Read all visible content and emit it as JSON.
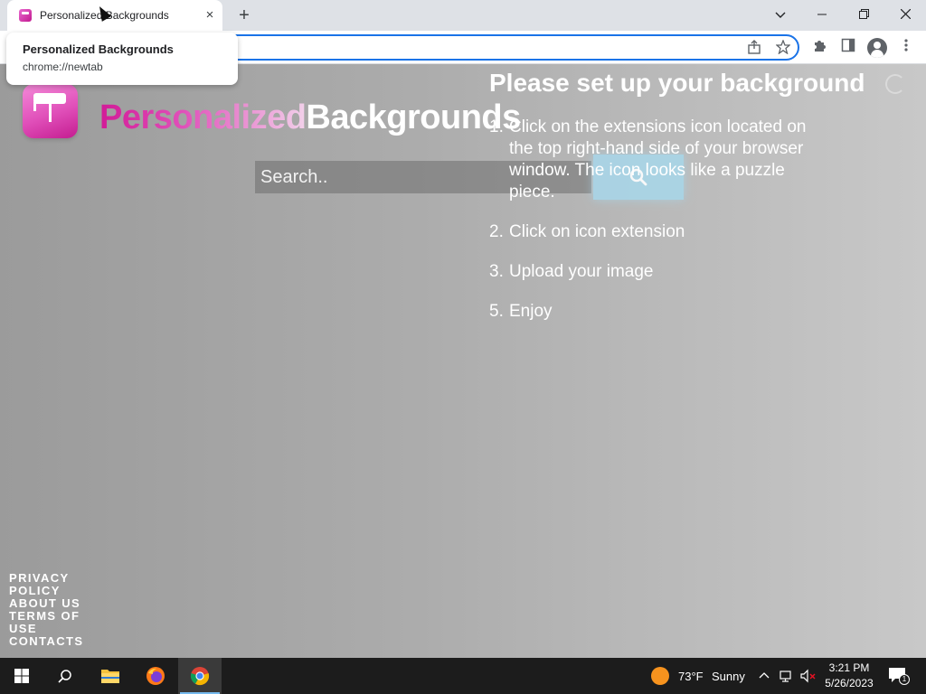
{
  "browser": {
    "tab_title": "Personalized Backgrounds",
    "tab_close": "×",
    "new_tab": "+",
    "tooltip_title": "Personalized Backgrounds",
    "tooltip_url": "chrome://newtab",
    "window_controls": [
      "chevron-down-icon",
      "minimize-icon",
      "restore-icon",
      "close-icon"
    ]
  },
  "page": {
    "brand_part1": "Personalized",
    "brand_part2": "Backgrounds",
    "search_placeholder": "Search..",
    "help_title": "Please set up your background",
    "steps": [
      {
        "num": "1.",
        "text": "Click on the extensions icon located on the top right-hand side of your browser window. The icon looks like a puzzle piece."
      },
      {
        "num": "2.",
        "text": "Click on icon extension"
      },
      {
        "num": "3.",
        "text": "Upload your image"
      },
      {
        "num": "5.",
        "text": "Enjoy"
      }
    ],
    "footer_links": [
      "PRIVACY POLICY",
      "ABOUT US",
      "TERMS OF USE",
      "CONTACTS"
    ]
  },
  "taskbar": {
    "weather_temp": "73°F",
    "weather_cond": "Sunny",
    "time": "3:21 PM",
    "date": "5/26/2023",
    "notification_count": "1"
  },
  "colors": {
    "brand_pink": "#d21b97",
    "search_button": "#a9d6e8",
    "chrome_accent": "#1a73e8",
    "taskbar_bg": "#1c1c1c"
  }
}
